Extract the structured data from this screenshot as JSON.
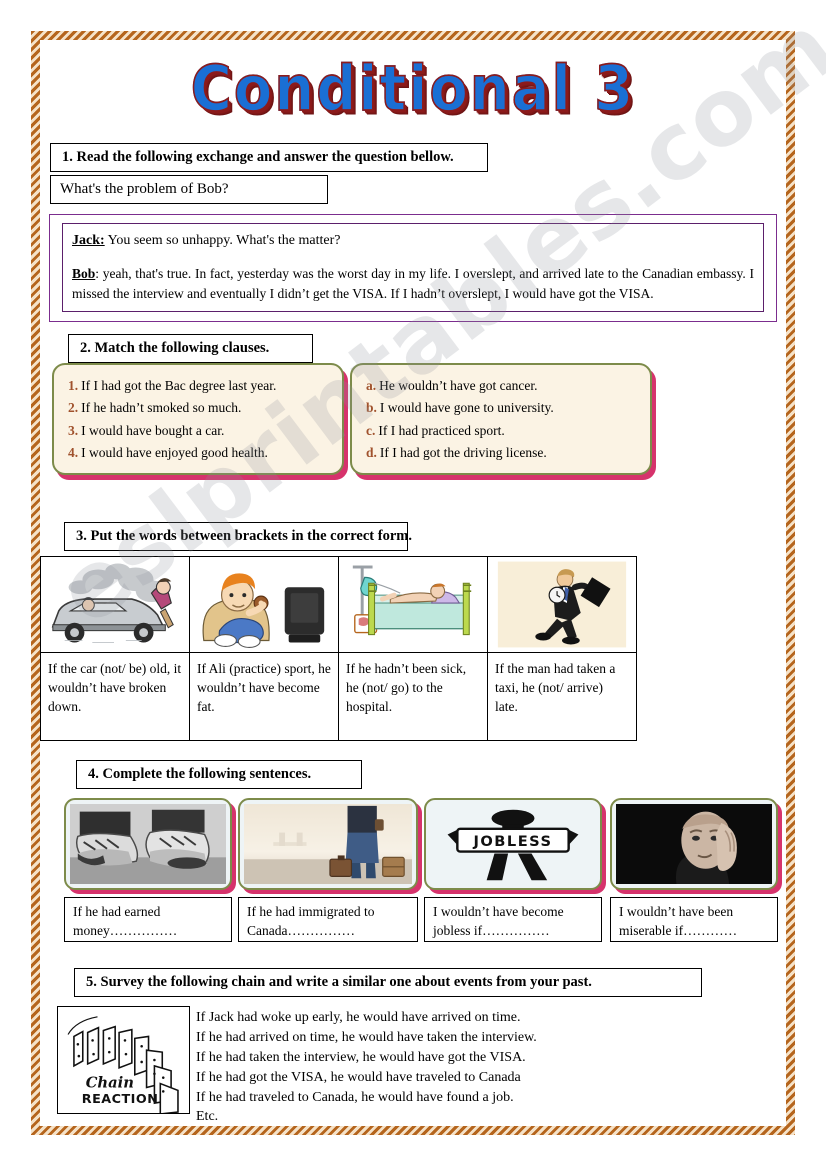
{
  "page": {
    "title": "Conditional  3",
    "watermark": "eslprintables.com",
    "border_color": "#b5651d"
  },
  "sections": {
    "s1": {
      "heading": "1. Read the following exchange and answer the question bellow.",
      "question": "What's the problem of Bob?",
      "dialogue": {
        "jack_name": "Jack:",
        "jack_line": " You seem so unhappy. What's the matter?",
        "bob_name": "Bob",
        "bob_line": ": yeah, that's true. In fact, yesterday was the worst day in my life. I overslept, and arrived late to the Canadian embassy. I missed the interview and eventually I didn’t get the VISA. If I hadn’t overslept, I would have got the VISA."
      }
    },
    "s2": {
      "heading": "2. Match the following clauses.",
      "left": [
        {
          "marker": "1.",
          "text": "If I had got the Bac degree last year."
        },
        {
          "marker": "2.",
          "text": "If he hadn’t smoked so much."
        },
        {
          "marker": "3.",
          "text": "I would have bought a car."
        },
        {
          "marker": "4.",
          "text": "I would have enjoyed good health."
        }
      ],
      "right": [
        {
          "marker": "a.",
          "text": "He wouldn’t have got cancer."
        },
        {
          "marker": "b.",
          "text": "I would have gone to university."
        },
        {
          "marker": "c.",
          "text": "If I had practiced sport."
        },
        {
          "marker": "d.",
          "text": "If I had got the driving license."
        }
      ]
    },
    "s3": {
      "heading": "3. Put the words between brackets in the correct form.",
      "items": [
        {
          "icon": "broken-car-illustration",
          "text": "If the car (not/ be) old, it wouldn’t have broken down."
        },
        {
          "icon": "overweight-boy-tv-illustration",
          "text": "If Ali (practice) sport, he wouldn’t have become fat."
        },
        {
          "icon": "hospital-bed-patient-illustration",
          "text": "If he hadn’t been sick, he (not/ go) to the hospital."
        },
        {
          "icon": "running-businessman-illustration",
          "text": "If the man had taken a taxi, he (not/ arrive) late."
        }
      ]
    },
    "s4": {
      "heading": "4. Complete the following sentences.",
      "items": [
        {
          "icon": "worn-shoes-photo",
          "text": "If he had earned money……………"
        },
        {
          "icon": "traveller-suitcases-photo",
          "text": "If he had immigrated to Canada……………"
        },
        {
          "icon": "jobless-sign-figure",
          "text": "I wouldn’t have become jobless if……………"
        },
        {
          "icon": "sad-man-photo",
          "text": "I wouldn’t have been miserable if…………"
        }
      ]
    },
    "s5": {
      "heading": "5. Survey the following chain and write a similar one about events from your past.",
      "image_caption_script": "Chain",
      "image_caption_block": "REACTION",
      "lines": [
        "If Jack had woke up early, he would have arrived on time.",
        "If he had arrived on time, he would have taken the interview.",
        "If he had taken the interview, he would have got the VISA.",
        "If he had got the VISA, he would have traveled to Canada",
        "If he had traveled to Canada, he would have found a job.",
        "Etc."
      ]
    }
  }
}
